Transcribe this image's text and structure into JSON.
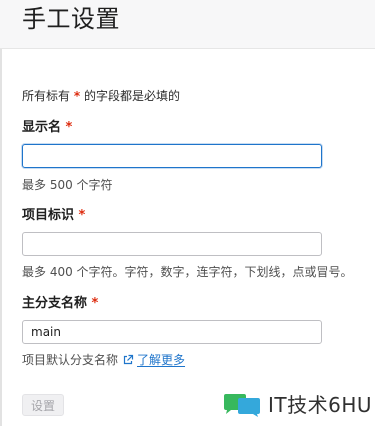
{
  "page": {
    "title": "手工设置"
  },
  "form": {
    "required_note_prefix": "所有标有",
    "required_marker": "*",
    "required_note_suffix": "的字段都是必填的",
    "display_name": {
      "label": "显示名",
      "value": "",
      "help": "最多 500 个字符"
    },
    "project_id": {
      "label": "项目标识",
      "value": "",
      "help": "最多 400 个字符。字符，数字，连字符，下划线，点或冒号。"
    },
    "main_branch": {
      "label": "主分支名称",
      "value": "main",
      "help": "项目默认分支名称",
      "learn_more": "了解更多"
    },
    "submit_label": "设置"
  },
  "watermark": {
    "text": "IT技术6HU"
  },
  "colors": {
    "accent": "#1f75cb",
    "required": "#dd2b0e",
    "header_bg": "#f7f7f8"
  },
  "icons": {
    "external_link": "external-link-icon",
    "watermark_logo": "wechat-logo-icon"
  }
}
